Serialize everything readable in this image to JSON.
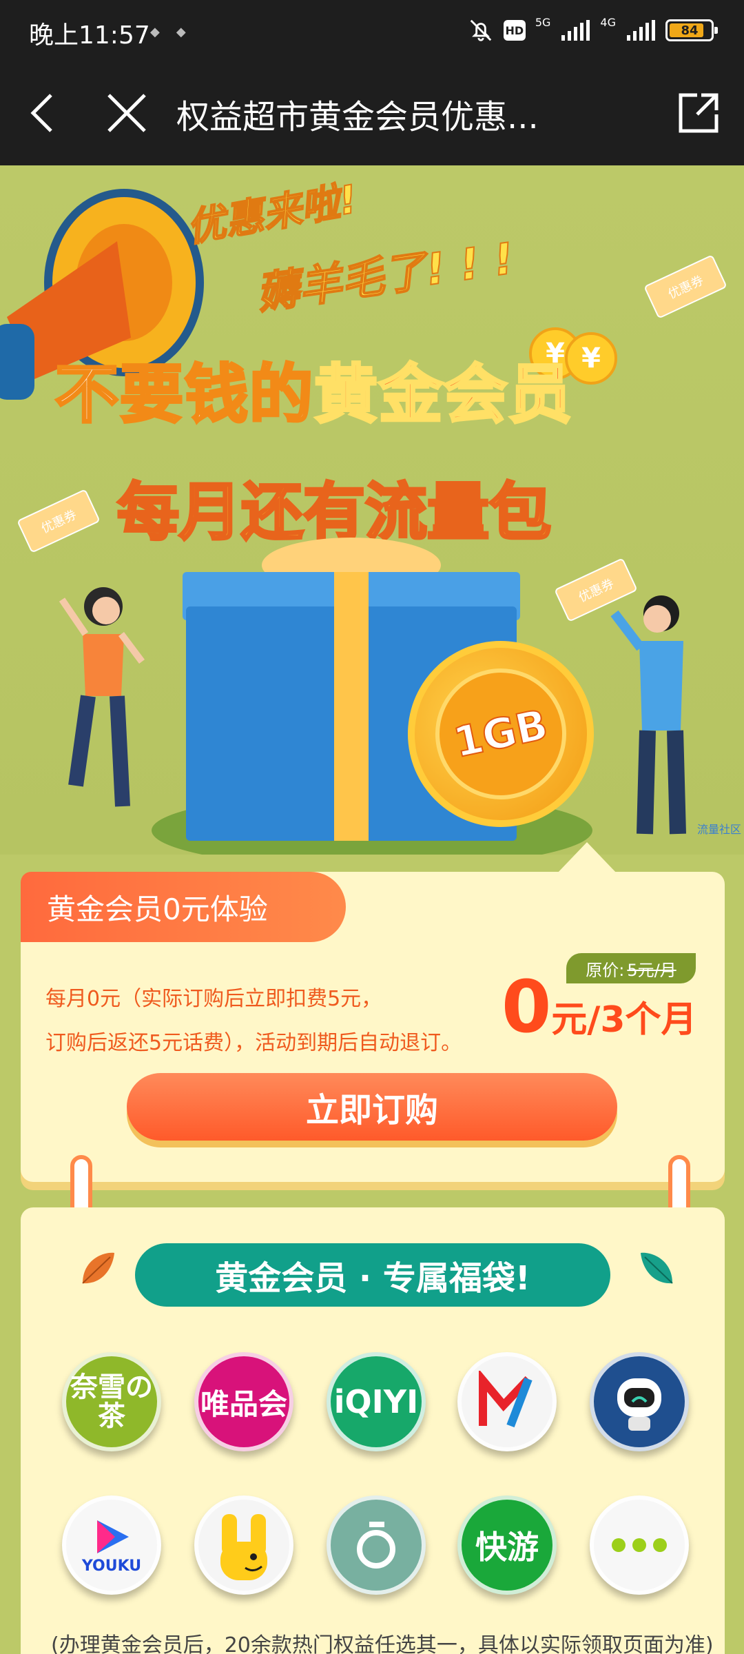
{
  "status_bar": {
    "time": "晚上11:57",
    "hd": "HD",
    "net1": "5G",
    "net2": "4G",
    "battery": "84",
    "battery_level": 0.84
  },
  "nav": {
    "title": "权益超市黄金会员优惠..."
  },
  "hero": {
    "slogan_line1": "优惠来啦!",
    "slogan_line2": "薅羊毛了! ! !",
    "title_line1_prefix": "不要钱的",
    "title_line1_highlight": "黄金会员",
    "title_line2": "每月还有流量包",
    "coin_label": "1GB",
    "coupon_label": "优惠券",
    "yuan_symbol": "¥",
    "watermark": "流量社区"
  },
  "offer": {
    "tab_label": "黄金会员0元体验",
    "desc_line1": "每月0元（实际订购后立即扣费5元，",
    "desc_line2": "订购后返还5元话费），活动到期后自动退订。",
    "orig_price_label": "原价:",
    "orig_price_value": "5元/月",
    "price_big": "0",
    "price_unit": "元/3个月",
    "subscribe_label": "立即订购"
  },
  "benefits": {
    "banner": "黄金会员 · 专属福袋!",
    "apps": [
      {
        "name": "奈雪の茶",
        "color": "#8fb82a"
      },
      {
        "name": "唯品会",
        "color": "#d8127a"
      },
      {
        "name": "iQIYI",
        "color": "#17a86a"
      },
      {
        "name": "芒果TV",
        "color": "#f5f5f5"
      },
      {
        "name": "robot",
        "color": "#1f4f8f"
      },
      {
        "name": "YOUKU",
        "color": "#f7f7f7"
      },
      {
        "name": "rabbit",
        "color": "#f5f5f5"
      },
      {
        "name": "ring",
        "color": "#78b0a0"
      },
      {
        "name": "快游",
        "color": "#1aa83a"
      },
      {
        "name": "...",
        "color": "#f7f7f7"
      }
    ],
    "footnote": "(办理黄金会员后，20余款热门权益任选其一，具体以实际领取页面为准)"
  }
}
